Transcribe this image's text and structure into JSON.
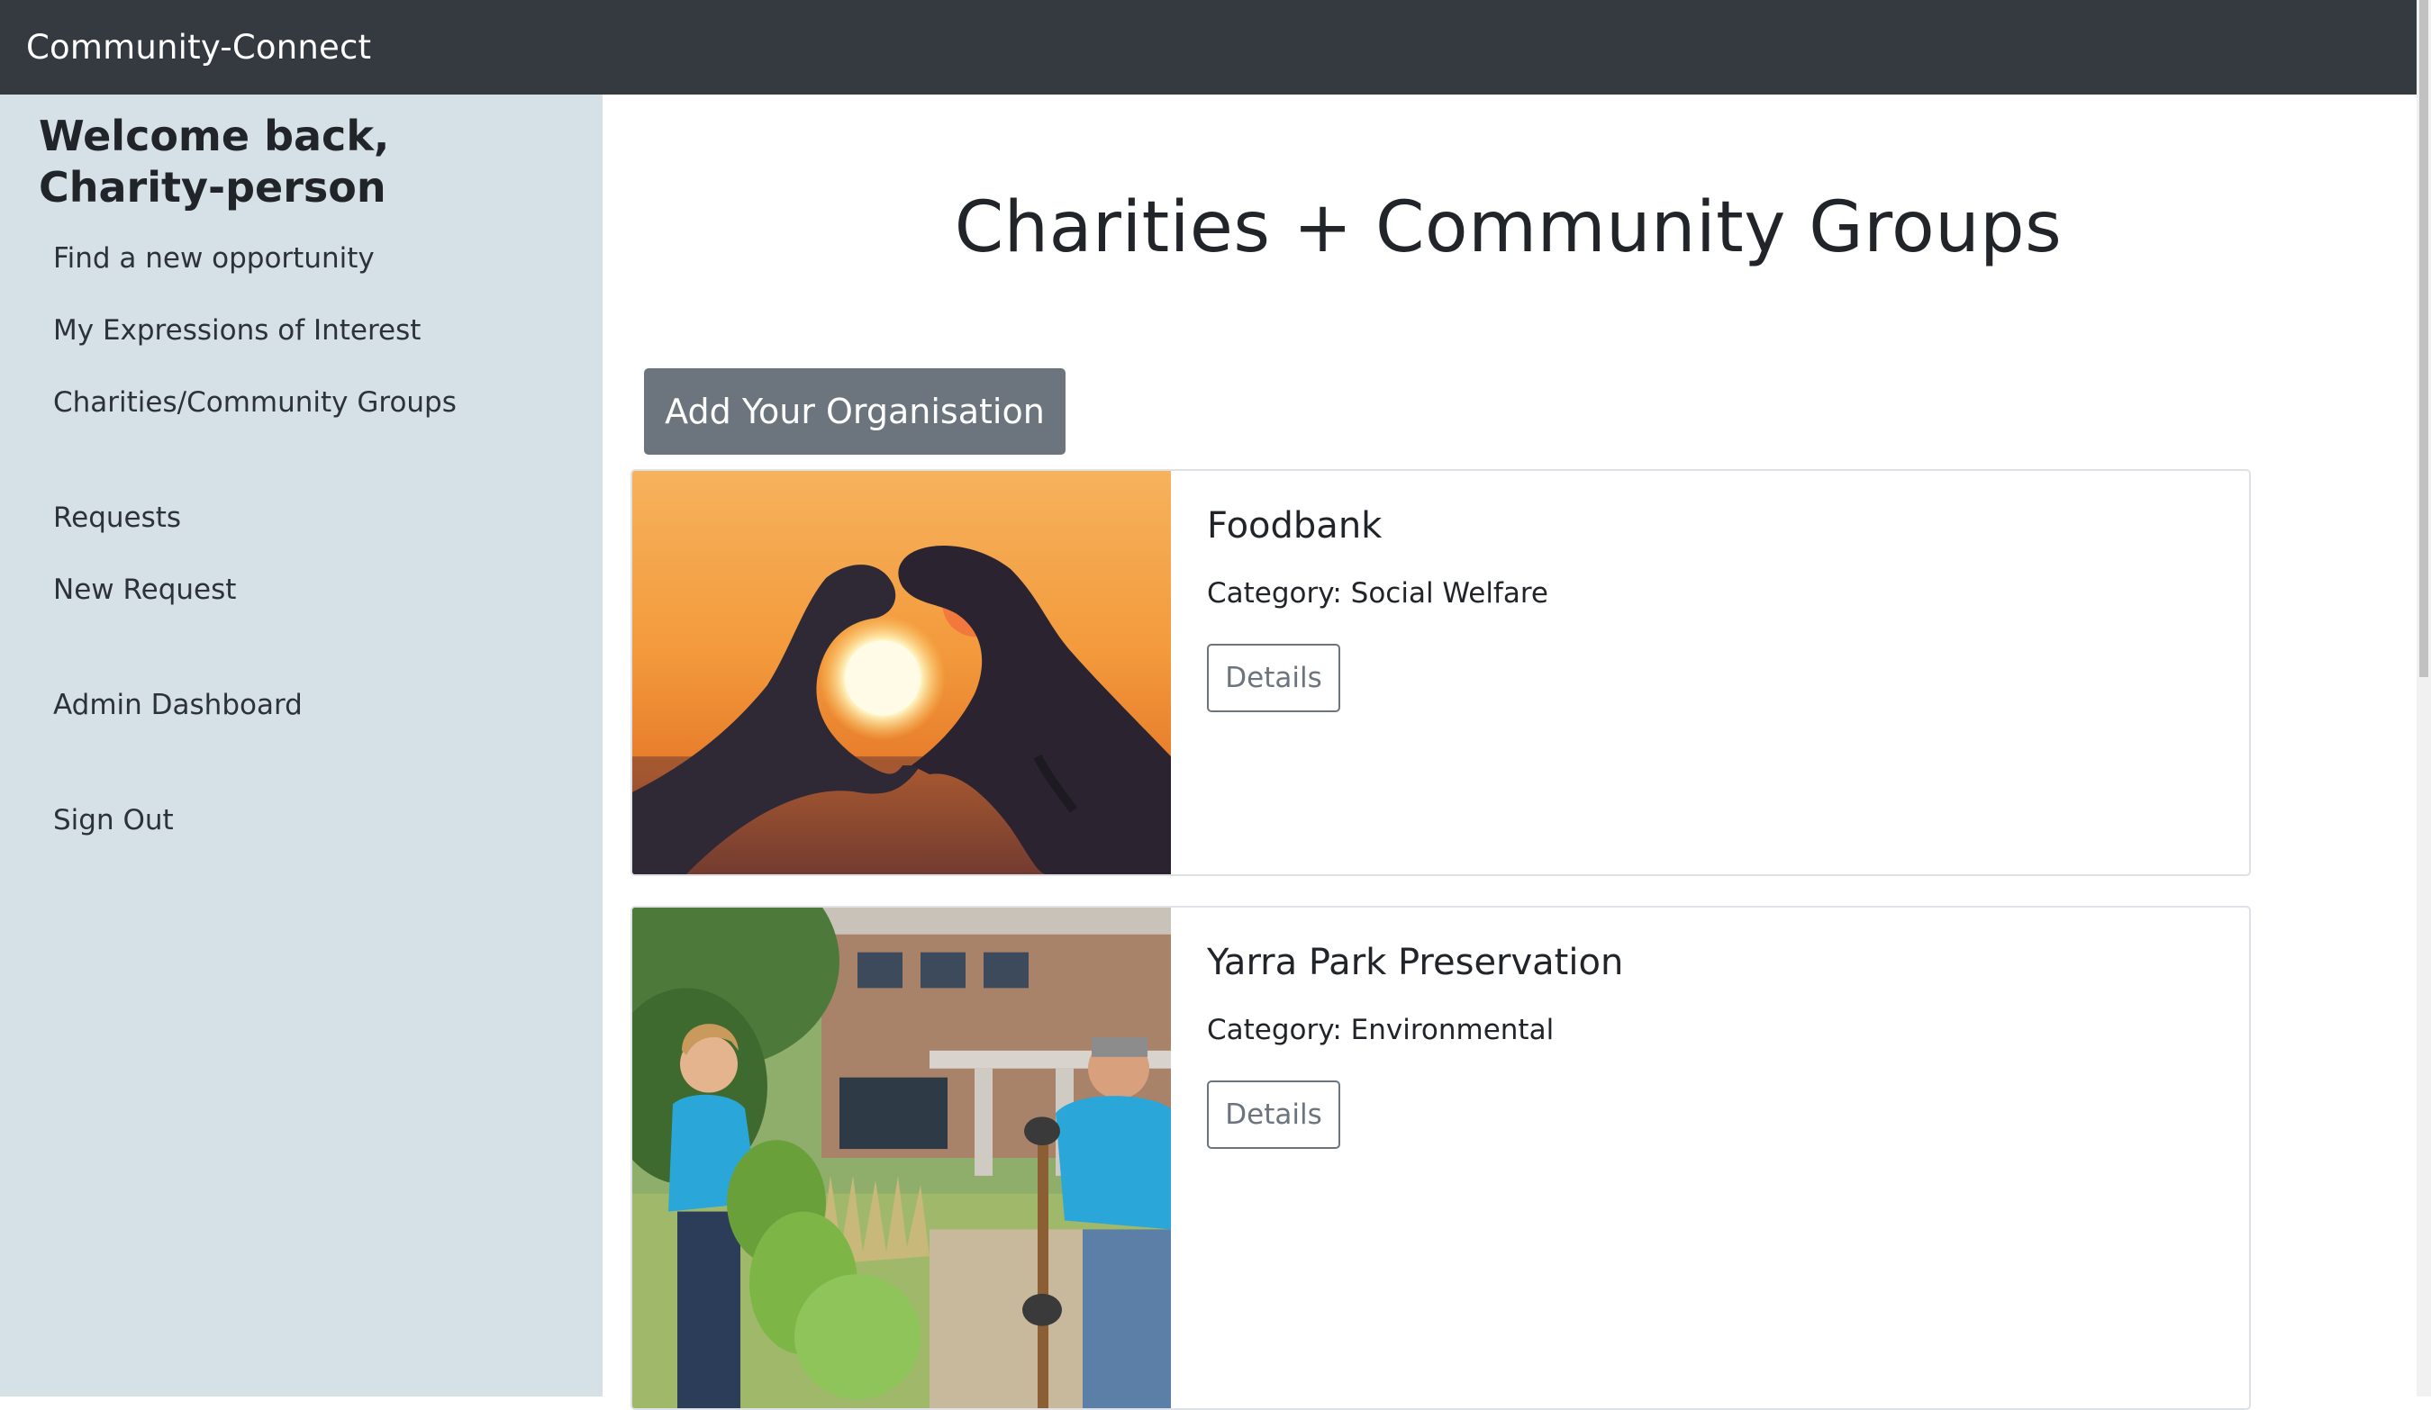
{
  "navbar": {
    "brand": "Community-Connect"
  },
  "sidebar": {
    "welcome": "Welcome back, Charity-person",
    "items": [
      {
        "label": "Find a new opportunity"
      },
      {
        "label": "My Expressions of Interest"
      },
      {
        "label": "Charities/Community Groups"
      },
      {
        "label": "Requests"
      },
      {
        "label": "New Request"
      },
      {
        "label": "Admin Dashboard"
      },
      {
        "label": "Sign Out"
      }
    ]
  },
  "main": {
    "title": "Charities + Community Groups",
    "add_button": "Add Your Organisation",
    "organisations": [
      {
        "name": "Foodbank",
        "category": "Category: Social Welfare",
        "details_label": "Details",
        "image": "hands-heart-sunset-photo"
      },
      {
        "name": "Yarra Park Preservation",
        "category": "Category: Environmental",
        "details_label": "Details",
        "image": "volunteers-planting-photo"
      }
    ]
  },
  "colors": {
    "navbar_bg": "#343a40",
    "sidebar_bg": "#d5e1e6",
    "secondary": "#6c757d"
  }
}
